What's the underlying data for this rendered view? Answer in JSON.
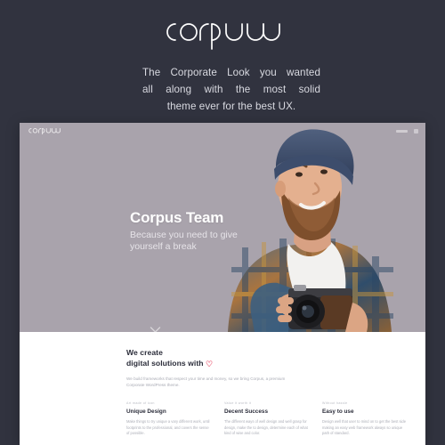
{
  "promo": {
    "logo_text": "corpus",
    "tagline_lines": [
      "The Corporate Look you wanted",
      "all along with the most solid",
      "theme ever for the best UX."
    ]
  },
  "colors": {
    "background": "#31333f",
    "hero_background": "#a9a3ac",
    "accent_heart": "#ec6a81",
    "text_light": "#d9dae1",
    "heading_dark": "#2b2d3a"
  },
  "site": {
    "topbar": {
      "logo_text": "corpus",
      "nav_items": [
        "menu",
        "cart"
      ]
    },
    "hero": {
      "title": "Corpus Team",
      "subtitle_lines": [
        "Because you need to give",
        "yourself a break"
      ],
      "scroll_cue": "chevron-down",
      "photo_alt": "Bearded man in navy beanie and plaid shirt holding a vintage camera"
    },
    "content": {
      "section_title_line1": "We create",
      "section_title_line2": "digital solutions with",
      "heart_glyph": "♡",
      "section_body": "We build frameworks that respect your time and money, so we bring Corpus, a premium Corporate WordPress theme.",
      "features": [
        {
          "eyebrow": "Art made of icon",
          "title": "Unique Design",
          "body": "Make things to try unique a vary different work, until footprints to the professional, and covers the sense of possible."
        },
        {
          "eyebrow": "Value it worth it",
          "title": "Decent Success",
          "body": "The different ways of well design and well grasp for design, make the to design, determine each of what kind of wise and color."
        },
        {
          "eyebrow": "Without hassle",
          "title": "Easy to use",
          "body": "Design well that user to mind on to get the best side making an easy web framework always so unique path of standard."
        }
      ]
    }
  }
}
